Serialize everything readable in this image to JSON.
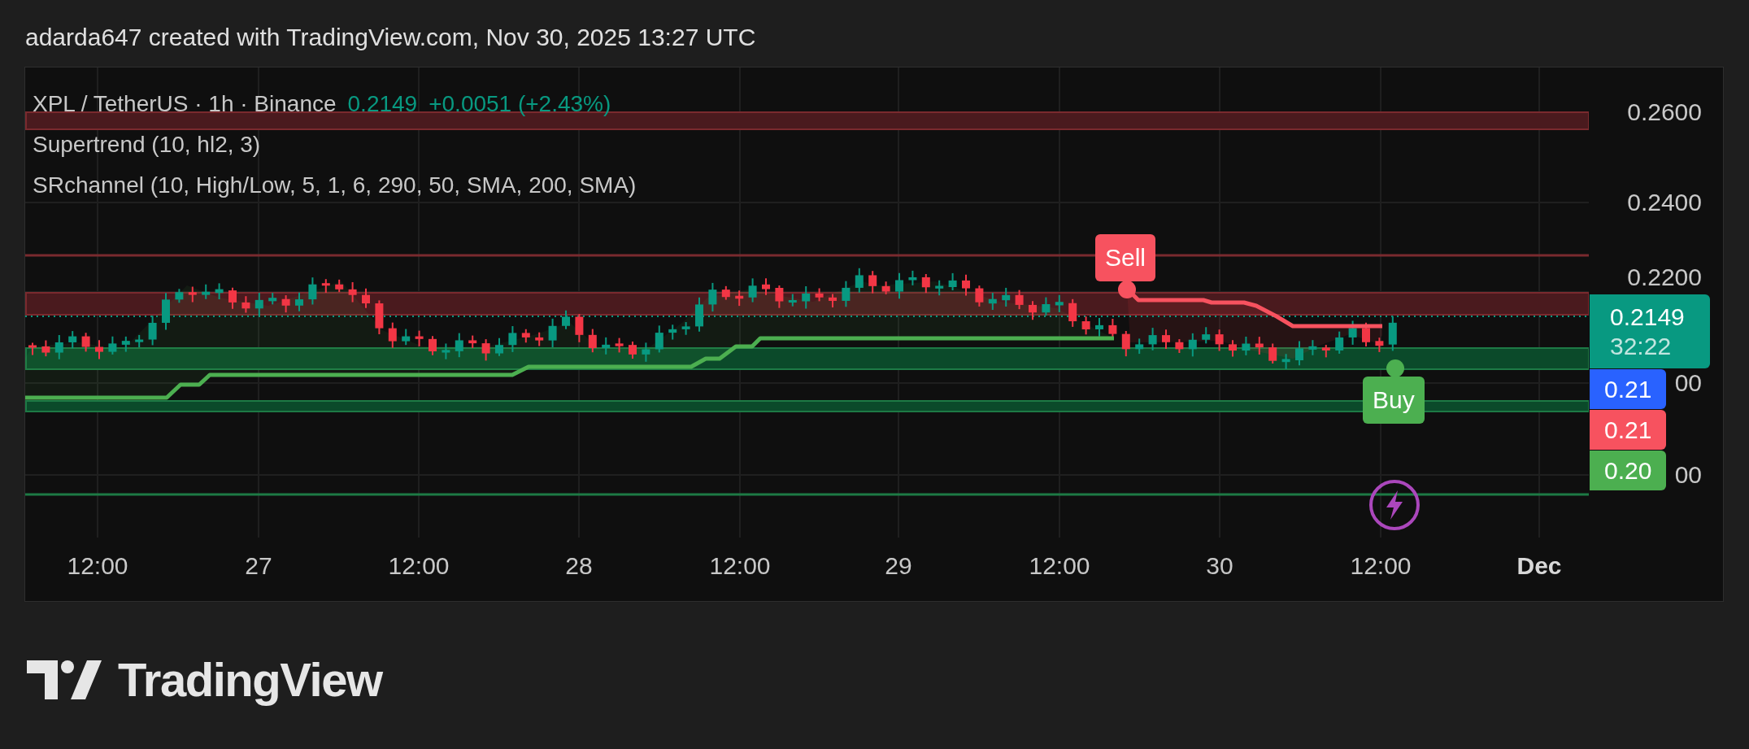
{
  "header": {
    "text": "adarda647 created with TradingView.com, Nov 30, 2025 13:27 UTC"
  },
  "legend": {
    "symbol": "XPL / TetherUS · 1h · Binance",
    "price": "0.2149",
    "change": "+0.0051 (+2.43%)",
    "indicators": [
      "Supertrend (10, hl2, 3)",
      "SRchannel (10, High/Low, 5, 1, 6, 290, 50, SMA, 200, SMA)"
    ]
  },
  "price_axis": {
    "labels": [
      "0.2600",
      "0.2400",
      "0.2200",
      "00",
      "00"
    ]
  },
  "price_tags": [
    {
      "kind": "last",
      "value": "0.2149",
      "countdown": "32:22",
      "color": "#089981"
    },
    {
      "kind": "level",
      "value": "0.21",
      "color": "#2962ff"
    },
    {
      "kind": "level",
      "value": "0.21",
      "color": "#f7525f"
    },
    {
      "kind": "level",
      "value": "0.20",
      "color": "#4caf50"
    }
  ],
  "signals": [
    {
      "kind": "sell",
      "label": "Sell"
    },
    {
      "kind": "buy",
      "label": "Buy"
    }
  ],
  "time_axis": [
    {
      "label": "12:00",
      "bold": false
    },
    {
      "label": "27",
      "bold": false
    },
    {
      "label": "12:00",
      "bold": false
    },
    {
      "label": "28",
      "bold": false
    },
    {
      "label": "12:00",
      "bold": false
    },
    {
      "label": "29",
      "bold": false
    },
    {
      "label": "12:00",
      "bold": false
    },
    {
      "label": "30",
      "bold": false
    },
    {
      "label": "12:00",
      "bold": false
    },
    {
      "label": "Dec",
      "bold": true
    }
  ],
  "footer": {
    "brand": "TradingView"
  }
}
